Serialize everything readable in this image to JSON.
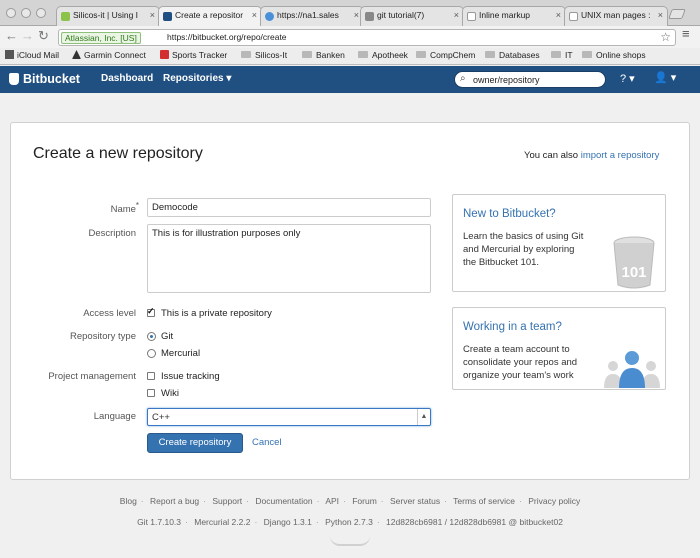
{
  "browser": {
    "tabs": [
      {
        "label": "Silicos-it | Using I",
        "fav": "#8bc34a"
      },
      {
        "label": "Create a repositor",
        "fav": "#205081"
      },
      {
        "label": "https://na1.sales",
        "fav": "#4a90d9"
      },
      {
        "label": "git tutorial(7)",
        "fav": "#888888"
      },
      {
        "label": "Inline markup",
        "fav": "#ffffff"
      },
      {
        "label": "UNIX man pages :",
        "fav": "#ffffff"
      }
    ],
    "ev_badge": "Atlassian, Inc. [US]",
    "url": "https://bitbucket.org/repo/create",
    "bookmarks": [
      "iCloud Mail",
      "Garmin Connect",
      "Sports Tracker",
      "Silicos-It",
      "Banken",
      "Apotheek",
      "CompChem",
      "Databases",
      "IT",
      "Online shops"
    ]
  },
  "header": {
    "logo": "Bitbucket",
    "nav_dashboard": "Dashboard",
    "nav_repositories": "Repositories ▾",
    "search_value": "owner/repository",
    "help": "? ▾",
    "avatar": "👤 ▾"
  },
  "form": {
    "title": "Create a new repository",
    "also_text": "You can also",
    "import_link": "import a repository",
    "name_label": "Name",
    "name_value": "Democode",
    "description_label": "Description",
    "description_value": "This is for illustration purposes only",
    "access_label": "Access level",
    "private_label": "This is a private repository",
    "repotype_label": "Repository type",
    "git_label": "Git",
    "mercurial_label": "Mercurial",
    "project_label": "Project management",
    "issue_label": "Issue tracking",
    "wiki_label": "Wiki",
    "language_label": "Language",
    "language_value": "C++",
    "create_button": "Create repository",
    "cancel_link": "Cancel"
  },
  "sidebar": {
    "new_title": "New to Bitbucket?",
    "new_text": "Learn the basics of using Git and Mercurial by exploring the Bitbucket 101.",
    "bucket_label": "101",
    "team_title": "Working in a team?",
    "team_text": "Create a team account to consolidate your repos and organize your team's work"
  },
  "footer": {
    "links": [
      "Blog",
      "Report a bug",
      "Support",
      "Documentation",
      "API",
      "Forum",
      "Server status",
      "Terms of service",
      "Privacy policy"
    ],
    "versions": [
      "Git 1.7.10.3",
      "Mercurial 2.2.2",
      "Django 1.3.1",
      "Python 2.7.3",
      "12d828cb6981 / 12d828db6981 @ bitbucket02"
    ]
  },
  "colors": {
    "brand": "#205081",
    "link": "#3572b0"
  }
}
